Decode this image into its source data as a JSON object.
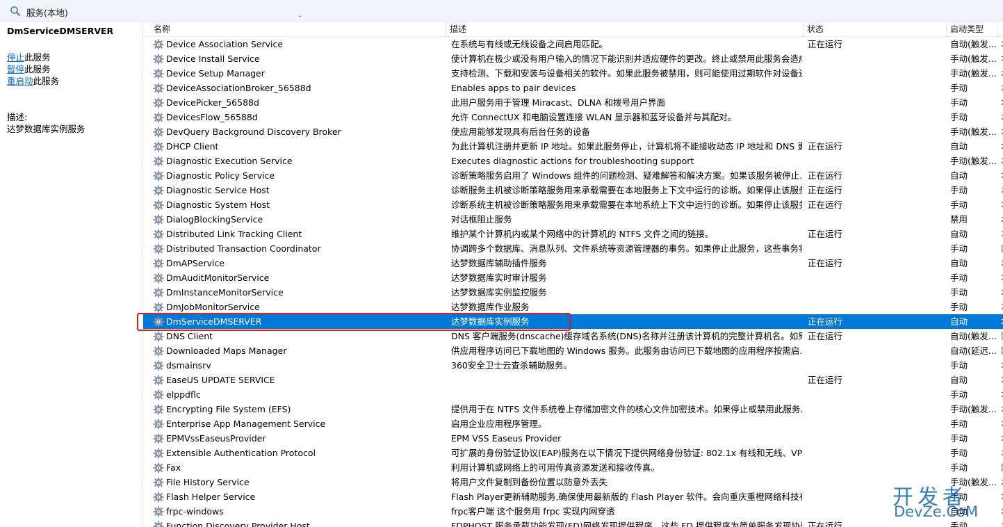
{
  "window": {
    "title": "服务(本地)"
  },
  "left_panel": {
    "service_name": "DmServiceDMSERVER",
    "actions": [
      {
        "link": "停止",
        "rest": "此服务"
      },
      {
        "link": "暂停",
        "rest": "此服务"
      },
      {
        "link": "重启动",
        "rest": "此服务"
      }
    ],
    "desc_label": "描述:",
    "desc_text": "达梦数据库实例服务"
  },
  "columns": {
    "name": "名称",
    "desc": "描述",
    "status": "状态",
    "start": "启动类型"
  },
  "colors": {
    "selection": "#0078d7",
    "highlight_box": "#e02020",
    "link": "#0066cc"
  },
  "selected_row_index": 19,
  "rows": [
    {
      "name": "Device Association Service",
      "desc": "在系统与有线或无线设备之间启用匹配。",
      "status": "正在运行",
      "start": "自动(触发...",
      "extra": "本"
    },
    {
      "name": "Device Install Service",
      "desc": "使计算机在极少或没有用户输入的情况下能识别并适应硬件的更改。终止或禁用此服务会造成...",
      "status": "",
      "start": "手动(触发...",
      "extra": "本"
    },
    {
      "name": "Device Setup Manager",
      "desc": "支持检测、下载和安装与设备相关的软件。如果此服务被禁用，则可能使用过期软件对设备进...",
      "status": "",
      "start": "手动(触发...",
      "extra": "本"
    },
    {
      "name": "DeviceAssociationBroker_56588d",
      "desc": "Enables apps to pair devices",
      "status": "",
      "start": "手动",
      "extra": "本"
    },
    {
      "name": "DevicePicker_56588d",
      "desc": "此用户服务用于管理 Miracast、DLNA 和拨号用户界面",
      "status": "",
      "start": "手动",
      "extra": "本"
    },
    {
      "name": "DevicesFlow_56588d",
      "desc": "允许 ConnectUX 和电脑设置连接 WLAN 显示器和蓝牙设备并与其配对。",
      "status": "",
      "start": "手动",
      "extra": "本"
    },
    {
      "name": "DevQuery Background Discovery Broker",
      "desc": "使应用能够发现具有后台任务的设备",
      "status": "",
      "start": "手动(触发...",
      "extra": "本"
    },
    {
      "name": "DHCP Client",
      "desc": "为此计算机注册并更新 IP 地址。如果此服务停止，计算机将不能接收动态 IP 地址和 DNS 更...",
      "status": "正在运行",
      "start": "自动",
      "extra": "本"
    },
    {
      "name": "Diagnostic Execution Service",
      "desc": "Executes diagnostic actions for troubleshooting support",
      "status": "",
      "start": "手动(触发...",
      "extra": "本"
    },
    {
      "name": "Diagnostic Policy Service",
      "desc": "诊断策略服务启用了 Windows 组件的问题检测、疑难解答和解决方案。如果该服务被停止...",
      "status": "正在运行",
      "start": "自动",
      "extra": "本"
    },
    {
      "name": "Diagnostic Service Host",
      "desc": "诊断服务主机被诊断策略服务用来承载需要在本地服务上下文中运行的诊断。如果停止该服务...",
      "status": "正在运行",
      "start": "手动",
      "extra": "本"
    },
    {
      "name": "Diagnostic System Host",
      "desc": "诊断系统主机被诊断策略服务用来承载需要在本地系统上下文中运行的诊断。如果停止该服务...",
      "status": "正在运行",
      "start": "手动",
      "extra": "本"
    },
    {
      "name": "DialogBlockingService",
      "desc": "对话框阻止服务",
      "status": "",
      "start": "禁用",
      "extra": "本"
    },
    {
      "name": "Distributed Link Tracking Client",
      "desc": "维护某个计算机内或某个网络中的计算机的 NTFS 文件之间的链接。",
      "status": "正在运行",
      "start": "自动",
      "extra": "本"
    },
    {
      "name": "Distributed Transaction Coordinator",
      "desc": "协调跨多个数据库、消息队列、文件系统等资源管理器的事务。如果停止此服务，这些事务将...",
      "status": "",
      "start": "手动",
      "extra": "网"
    },
    {
      "name": "DmAPService",
      "desc": "达梦数据库辅助插件服务",
      "status": "正在运行",
      "start": "自动",
      "extra": "本"
    },
    {
      "name": "DmAuditMonitorService",
      "desc": "达梦数据库实时审计服务",
      "status": "",
      "start": "手动",
      "extra": "本"
    },
    {
      "name": "DmInstanceMonitorService",
      "desc": "达梦数据库实例监控服务",
      "status": "",
      "start": "手动",
      "extra": "本"
    },
    {
      "name": "DmJobMonitorService",
      "desc": "达梦数据库作业服务",
      "status": "",
      "start": "手动",
      "extra": "本"
    },
    {
      "name": "DmServiceDMSERVER",
      "desc": "达梦数据库实例服务",
      "status": "正在运行",
      "start": "自动",
      "extra": "本"
    },
    {
      "name": "DNS Client",
      "desc": "DNS 客户端服务(dnscache)缓存域名系统(DNS)名称并注册该计算机的完整计算机名。如果...",
      "status": "正在运行",
      "start": "自动(触发...",
      "extra": "网"
    },
    {
      "name": "Downloaded Maps Manager",
      "desc": "供应用程序访问已下载地图的 Windows 服务。此服务由访问已下载地图的应用程序按需启...",
      "status": "",
      "start": "自动(延迟...",
      "extra": "网"
    },
    {
      "name": "dsmainsrv",
      "desc": "360安全卫士云查杀辅助服务。",
      "status": "",
      "start": "手动",
      "extra": "本"
    },
    {
      "name": "EaseUS UPDATE SERVICE",
      "desc": "",
      "status": "正在运行",
      "start": "自动",
      "extra": "本"
    },
    {
      "name": "elppdflc",
      "desc": "",
      "status": "",
      "start": "手动",
      "extra": "本"
    },
    {
      "name": "Encrypting File System (EFS)",
      "desc": "提供用于在 NTFS 文件系统卷上存储加密文件的核心文件加密技术。如果停止或禁用此服务...",
      "status": "",
      "start": "手动(触发...",
      "extra": "本"
    },
    {
      "name": "Enterprise App Management Service",
      "desc": "启用企业应用程序管理。",
      "status": "",
      "start": "手动",
      "extra": "本"
    },
    {
      "name": "EPMVssEaseusProvider",
      "desc": "EPM VSS Easeus Provider",
      "status": "",
      "start": "手动",
      "extra": "本"
    },
    {
      "name": "Extensible Authentication Protocol",
      "desc": "可扩展的身份验证协议(EAP)服务在以下情况下提供网络身份验证: 802.1x 有线和无线、VPN ...",
      "status": "",
      "start": "手动",
      "extra": "本"
    },
    {
      "name": "Fax",
      "desc": "利用计算机或网络上的可用传真资源发送和接收传真。",
      "status": "",
      "start": "手动",
      "extra": "网"
    },
    {
      "name": "File History Service",
      "desc": "将用户文件复制到备份位置以防意外丢失",
      "status": "",
      "start": "手动(触发...",
      "extra": "本"
    },
    {
      "name": "Flash Helper Service",
      "desc": "Flash Player更新辅助服务,确保使用最新版的 Flash Player 软件。会向重庆重橙网络科技有...",
      "status": "",
      "start": "手动",
      "extra": "本"
    },
    {
      "name": "frpc-windows",
      "desc": "frpc客户端 这个服务用 frpc 实现内网穿透",
      "status": "",
      "start": "自动",
      "extra": "本"
    },
    {
      "name": "Function Discovery Provider Host",
      "desc": "FDPHOST 服务承载功能发现(FD)网络发现提供程序。这些 FD 提供程序为简单服务发现协议...",
      "status": "正在运行",
      "start": "手动",
      "extra": "本"
    }
  ],
  "watermark": {
    "cn": "开发者",
    "en": "DevZe.CoM"
  }
}
